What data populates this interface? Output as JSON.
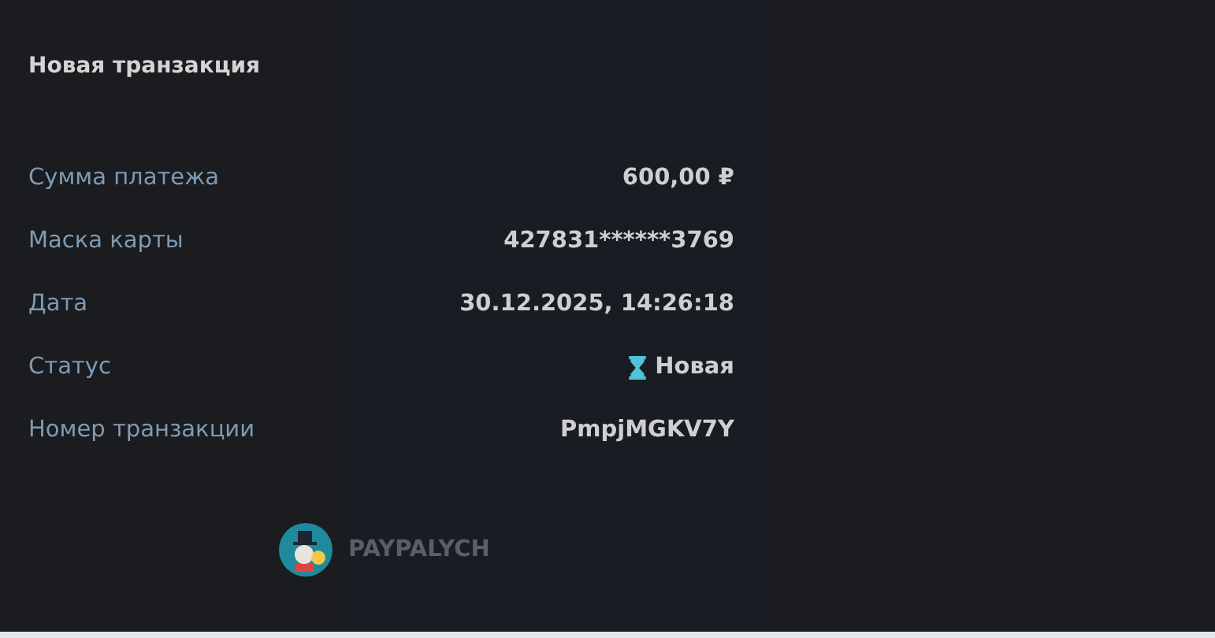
{
  "title": "Новая транзакция",
  "details": [
    {
      "label": "Сумма платежа",
      "value": "600,00 ₽",
      "kind": "text"
    },
    {
      "label": "Маска карты",
      "value": "427831******3769",
      "kind": "text"
    },
    {
      "label": "Дата",
      "value": "30.12.2025, 14:26:18",
      "kind": "text"
    },
    {
      "label": "Статус",
      "value": "Новая",
      "kind": "status"
    },
    {
      "label": "Номер транзакции",
      "value": "PmpjMGKV7Y",
      "kind": "text"
    }
  ],
  "brand": {
    "name": "PAYPALYCH"
  }
}
